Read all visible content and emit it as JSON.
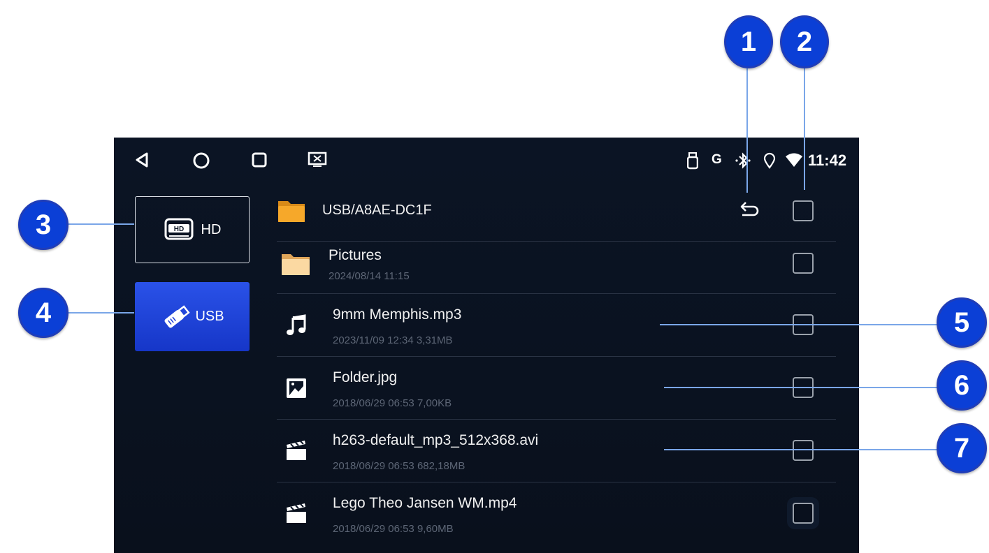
{
  "status_bar": {
    "nav": [
      "back-icon",
      "home-icon",
      "recents-icon",
      "screen-icon"
    ],
    "indicators": [
      "usb-icon",
      "g-icon",
      "bluetooth-icon",
      "location-icon",
      "wifi-icon"
    ],
    "time": "11:42"
  },
  "sidebar": {
    "items": [
      {
        "label": "HD",
        "icon": "hd-drive-icon",
        "selected": false
      },
      {
        "label": "USB",
        "icon": "usb-stick-icon",
        "selected": true
      }
    ]
  },
  "header": {
    "path": "USB/A8AE-DC1F",
    "back_icon": "return-icon"
  },
  "files": [
    {
      "name": "Pictures",
      "meta": "2024/08/14 11:15",
      "type": "folder"
    },
    {
      "name": "9mm Memphis.mp3",
      "meta": "2023/11/09 12:34  3,31MB",
      "type": "audio"
    },
    {
      "name": "Folder.jpg",
      "meta": "2018/06/29 06:53  7,00KB",
      "type": "image"
    },
    {
      "name": "h263-default_mp3_512x368.avi",
      "meta": "2018/06/29 06:53  682,18MB",
      "type": "video"
    },
    {
      "name": "Lego Theo Jansen WM.mp4",
      "meta": "2018/06/29 06:53  9,60MB",
      "type": "video"
    }
  ],
  "callouts": [
    "1",
    "2",
    "3",
    "4",
    "5",
    "6",
    "7"
  ],
  "colors": {
    "screen_bg": "#0b1424",
    "usb_selected": "#1f3fd8",
    "callout": "#0b3fd6",
    "folder": "#f0a830"
  }
}
